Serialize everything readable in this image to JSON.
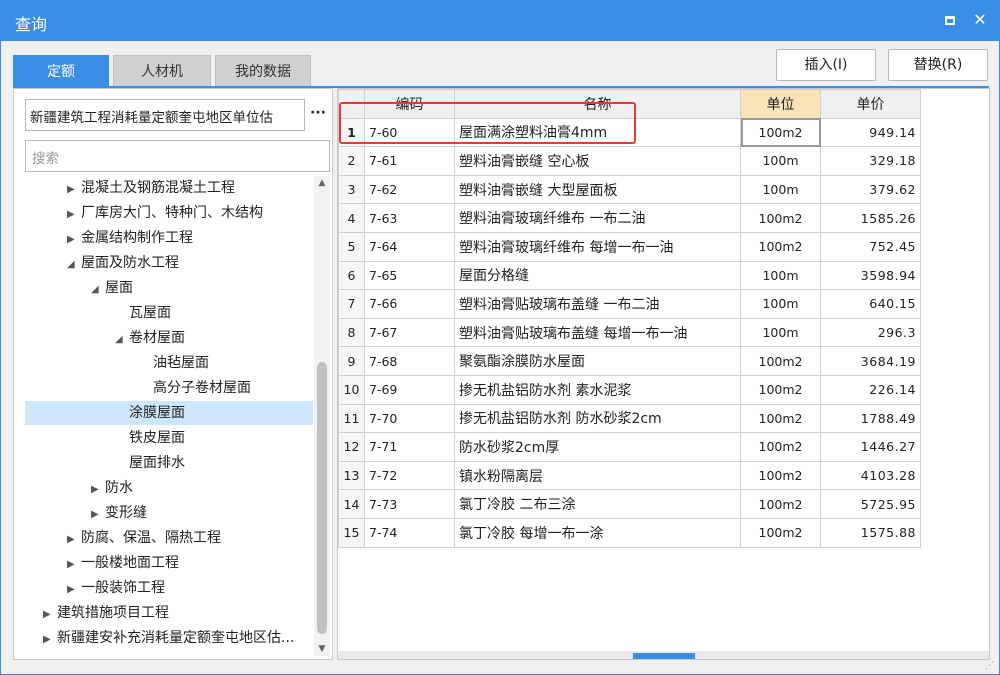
{
  "window": {
    "title": "查询",
    "maximize_icon": "maximize-icon",
    "close_icon": "close-icon",
    "close_glyph": "✕"
  },
  "tabs": [
    {
      "label": "定额",
      "active": true
    },
    {
      "label": "人材机",
      "active": false
    },
    {
      "label": "我的数据",
      "active": false
    }
  ],
  "buttons": {
    "insert": "插入(I)",
    "replace": "替换(R)"
  },
  "left": {
    "library": "新疆建筑工程消耗量定额奎屯地区单位估",
    "library_button": "···",
    "search_placeholder": "搜索",
    "tree": [
      {
        "label": "混凝土及钢筋混凝土工程",
        "arrow": "▶"
      },
      {
        "label": "厂库房大门、特种门、木结构",
        "arrow": "▶"
      },
      {
        "label": "金属结构制作工程",
        "arrow": "▶"
      },
      {
        "label": "屋面及防水工程",
        "arrow": "◢"
      },
      {
        "label": "屋面",
        "arrow": "◢"
      },
      {
        "label": "瓦屋面",
        "arrow": ""
      },
      {
        "label": "卷材屋面",
        "arrow": "◢"
      },
      {
        "label": "油毡屋面",
        "arrow": ""
      },
      {
        "label": "高分子卷材屋面",
        "arrow": ""
      },
      {
        "label": "涂膜屋面",
        "arrow": "",
        "selected": true
      },
      {
        "label": "铁皮屋面",
        "arrow": ""
      },
      {
        "label": "屋面排水",
        "arrow": ""
      },
      {
        "label": "防水",
        "arrow": "▶"
      },
      {
        "label": "变形缝",
        "arrow": "▶"
      },
      {
        "label": "防腐、保温、隔热工程",
        "arrow": "▶"
      },
      {
        "label": "一般楼地面工程",
        "arrow": "▶"
      },
      {
        "label": "一般装饰工程",
        "arrow": "▶"
      },
      {
        "label": "建筑措施项目工程",
        "arrow": "▶"
      },
      {
        "label": "新疆建安补充消耗量定额奎屯地区估...",
        "arrow": "▶"
      }
    ]
  },
  "table": {
    "headers": [
      "",
      "编码",
      "名称",
      "单位",
      "单价"
    ],
    "rows": [
      {
        "idx": "1",
        "code": "7-60",
        "name": "屋面满涂塑料油膏4mm",
        "unit": "100m2",
        "price": "949.14"
      },
      {
        "idx": "2",
        "code": "7-61",
        "name": "塑料油膏嵌缝 空心板",
        "unit": "100m",
        "price": "329.18"
      },
      {
        "idx": "3",
        "code": "7-62",
        "name": "塑料油膏嵌缝 大型屋面板",
        "unit": "100m",
        "price": "379.62"
      },
      {
        "idx": "4",
        "code": "7-63",
        "name": "塑料油膏玻璃纤维布 一布二油",
        "unit": "100m2",
        "price": "1585.26"
      },
      {
        "idx": "5",
        "code": "7-64",
        "name": "塑料油膏玻璃纤维布 每增一布一油",
        "unit": "100m2",
        "price": "752.45"
      },
      {
        "idx": "6",
        "code": "7-65",
        "name": "屋面分格缝",
        "unit": "100m",
        "price": "3598.94"
      },
      {
        "idx": "7",
        "code": "7-66",
        "name": "塑料油膏贴玻璃布盖缝 一布二油",
        "unit": "100m",
        "price": "640.15"
      },
      {
        "idx": "8",
        "code": "7-67",
        "name": "塑料油膏贴玻璃布盖缝 每增一布一油",
        "unit": "100m",
        "price": "296.3"
      },
      {
        "idx": "9",
        "code": "7-68",
        "name": "聚氨酯涂膜防水屋面",
        "unit": "100m2",
        "price": "3684.19"
      },
      {
        "idx": "10",
        "code": "7-69",
        "name": "掺无机盐铝防水剂 素水泥浆",
        "unit": "100m2",
        "price": "226.14"
      },
      {
        "idx": "11",
        "code": "7-70",
        "name": "掺无机盐铝防水剂 防水砂浆2cm",
        "unit": "100m2",
        "price": "1788.49"
      },
      {
        "idx": "12",
        "code": "7-71",
        "name": "防水砂浆2cm厚",
        "unit": "100m2",
        "price": "1446.27"
      },
      {
        "idx": "13",
        "code": "7-72",
        "name": "镇水粉隔离层",
        "unit": "100m2",
        "price": "4103.28"
      },
      {
        "idx": "14",
        "code": "7-73",
        "name": "氯丁冷胶 二布三涂",
        "unit": "100m2",
        "price": "5725.95"
      },
      {
        "idx": "15",
        "code": "7-74",
        "name": "氯丁冷胶 每增一布一涂",
        "unit": "100m2",
        "price": "1575.88"
      }
    ]
  },
  "colors": {
    "accent": "#3a8ee6",
    "highlight_box": "#e53935",
    "unit_header": "#f9e3b9",
    "selected_node": "#cde6fb"
  }
}
